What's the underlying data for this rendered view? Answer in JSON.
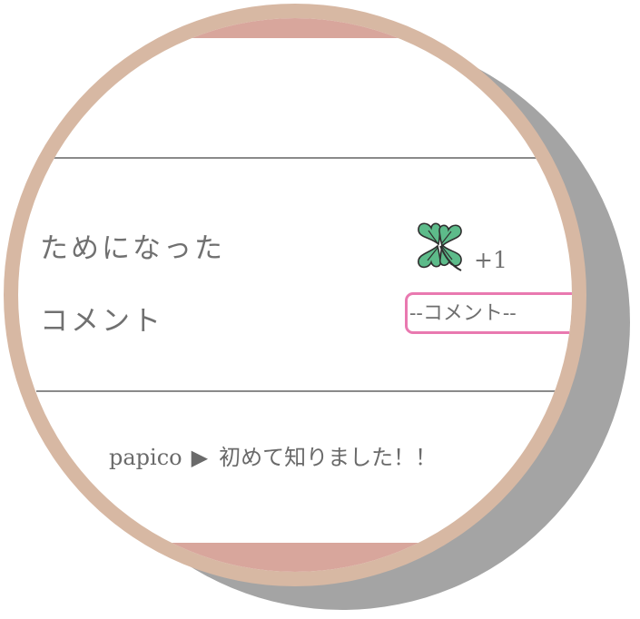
{
  "reaction": {
    "label": "ためになった",
    "icon": "four-leaf-clover-icon",
    "count": "+1"
  },
  "comment": {
    "label": "コメント",
    "placeholder": "--コメント--"
  },
  "comments_list": [
    {
      "author": "papico",
      "separator": "▶",
      "text": "初めて知りました！！"
    }
  ],
  "colors": {
    "frame": "#d7b8a3",
    "band": "#d8a69c",
    "shadow": "#a4a4a4",
    "input_border": "#e979b0",
    "clover": "#5dbb8a"
  }
}
